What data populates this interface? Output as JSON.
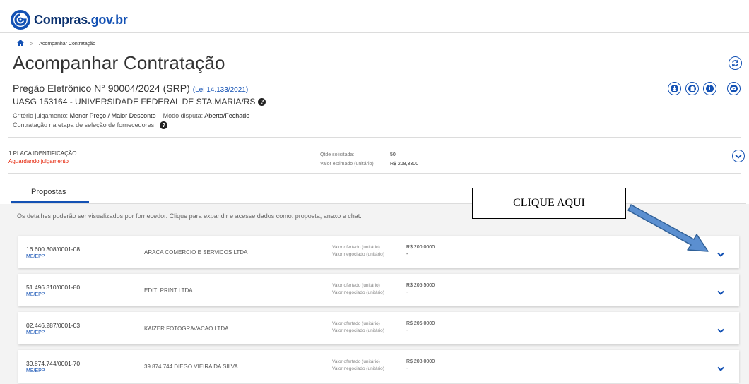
{
  "header": {
    "logo_text_main": "Compras.",
    "logo_text_gov": "gov.br"
  },
  "breadcrumb": {
    "current": "Acompanhar Contratação"
  },
  "page": {
    "title": "Acompanhar Contratação"
  },
  "process": {
    "title": "Pregão Eletrônico N° 90004/2024 (SRP)",
    "law": "(Lei 14.133/2021)",
    "uasg": "UASG 153164 - UNIVERSIDADE FEDERAL DE STA.MARIA/RS",
    "criteria_label": "Critério julgamento:",
    "criteria_value": "Menor Preço / Maior Desconto",
    "dispute_label": "Modo disputa:",
    "dispute_value": "Aberto/Fechado",
    "stage": "Contratação na etapa de seleção de fornecedores"
  },
  "item": {
    "number_name": "1  PLACA IDENTIFICAÇÃO",
    "status": "Aguardando julgamento",
    "qty_label": "Qtde solicitada:",
    "qty_value": "50",
    "est_label": "Valor estimado (unitário)",
    "est_value": "R$ 208,3300"
  },
  "tabs": {
    "proposals": "Propostas"
  },
  "description": "Os detalhes poderão ser visualizados por fornecedor. Clique para expandir e acesse dados como: proposta, anexo e chat.",
  "callout": "CLIQUE AQUI",
  "labels": {
    "offered": "Valor ofertado (unitário)",
    "negotiated": "Valor negociado (unitário)"
  },
  "proposals": [
    {
      "cnpj": "16.600.308/0001-08",
      "size": "ME/EPP",
      "name": "ARACA COMERCIO E SERVICOS LTDA",
      "offered": "R$ 200,0000",
      "negotiated": "-"
    },
    {
      "cnpj": "51.496.310/0001-80",
      "size": "ME/EPP",
      "name": "EDITI PRINT LTDA",
      "offered": "R$ 205,5000",
      "negotiated": "-"
    },
    {
      "cnpj": "02.446.287/0001-03",
      "size": "ME/EPP",
      "name": "KAIZER FOTOGRAVACAO LTDA",
      "offered": "R$ 206,0000",
      "negotiated": "-"
    },
    {
      "cnpj": "39.874.744/0001-70",
      "size": "ME/EPP",
      "name": "39.874.744 DIEGO VIEIRA DA SILVA",
      "offered": "R$ 208,0000",
      "negotiated": "-"
    }
  ],
  "colors": {
    "primary": "#1351b4",
    "danger": "#e52207",
    "arrow": "#5b8fd0"
  },
  "icons": [
    "logo-icon",
    "home-icon",
    "refresh-icon",
    "download-icon",
    "clipboard-icon",
    "info-icon",
    "mail-icon",
    "help-icon",
    "chevron-down-icon",
    "arrow-icon"
  ]
}
